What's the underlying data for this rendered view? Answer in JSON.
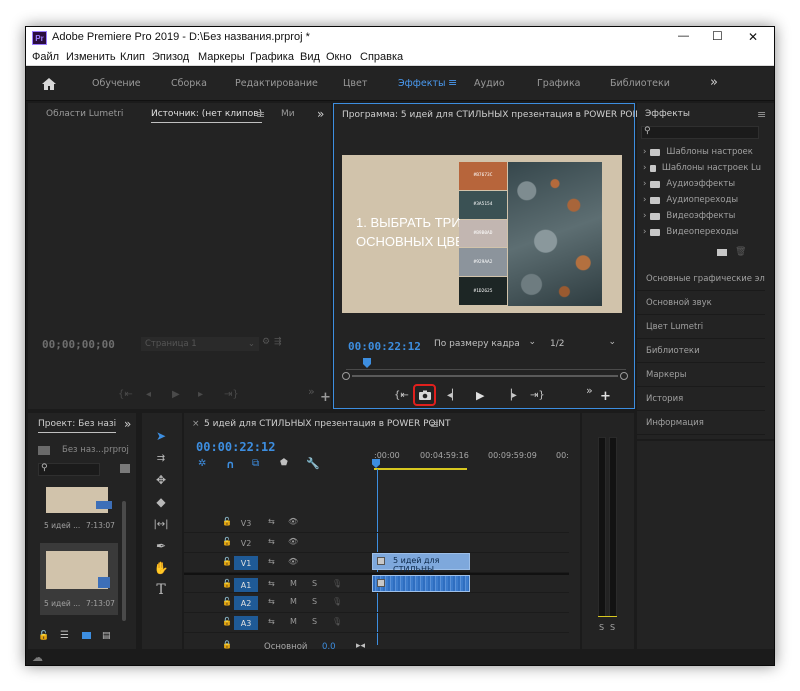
{
  "window": {
    "title": "Adobe Premiere Pro 2019 - D:\\Без названия.prproj *",
    "app_badge": "Pr",
    "minimize": "—",
    "maximize": "☐",
    "close": "✕"
  },
  "menu": [
    "Файл",
    "Изменить",
    "Клип",
    "Эпизод",
    "Маркеры",
    "Графика",
    "Вид",
    "Окно",
    "Справка"
  ],
  "workspaces": {
    "items": [
      "Обучение",
      "Сборка",
      "Редактирование",
      "Цвет",
      "Эффекты",
      "Аудио",
      "Графика",
      "Библиотеки"
    ],
    "active": "Эффекты",
    "more": "»"
  },
  "source": {
    "tabs": [
      "Области Lumetri",
      "Источник: (нет клипов)",
      "Ми"
    ],
    "timecode": "00;00;00;00",
    "page_select": "Страница 1"
  },
  "program": {
    "title": "Программа: 5 идей для СТИЛЬНЫХ презентация в POWER POINT",
    "timecode": "00:00:22:12",
    "fit_select": "По размеру кадра",
    "res_select": "1/2",
    "slide_text_line1": "1. ВЫБРАТЬ ТРИ",
    "slide_text_line2": "ОСНОВНЫХ ЦВЕТА",
    "swatches": [
      {
        "label": "#B7673C",
        "color": "#b7653b"
      },
      {
        "label": "#3A5154",
        "color": "#3a5154"
      },
      {
        "label": "#B9B0AD",
        "color": "#c2b6b1"
      },
      {
        "label": "#929AA2",
        "color": "#8c949c"
      },
      {
        "label": "#1D2625",
        "color": "#1d2625"
      }
    ],
    "slide_colors": {
      "background": "#d1c3ab"
    }
  },
  "effects": {
    "title": "Эффекты",
    "menu": "≡",
    "items": [
      "Шаблоны настроек",
      "Шаблоны настроек Lu",
      "Аудиоэффекты",
      "Аудиопереходы",
      "Видеоэффекты",
      "Видеопереходы"
    ],
    "sections": [
      "Основные графические эле",
      "Основной звук",
      "Цвет Lumetri",
      "Библиотеки",
      "Маркеры",
      "История",
      "Информация"
    ]
  },
  "project": {
    "tab": "Проект: Без назі",
    "file": "Без наз...prproj",
    "clips": [
      {
        "name": "5 идей ...",
        "duration": "7:13:07"
      },
      {
        "name": "5 идей ...",
        "duration": "7:13:07"
      }
    ]
  },
  "timeline": {
    "title": "5 идей для СТИЛЬНЫХ презентация в POWER POINT",
    "timecode": "00:00:22:12",
    "ruler": [
      ":00:00",
      "00:04:59:16",
      "00:09:59:09",
      "00:"
    ],
    "tracks": [
      {
        "name": "V3",
        "type": "video",
        "active": false
      },
      {
        "name": "V2",
        "type": "video",
        "active": false
      },
      {
        "name": "V1",
        "type": "video",
        "active": true
      },
      {
        "name": "A1",
        "type": "audio",
        "active": true
      },
      {
        "name": "A2",
        "type": "audio",
        "active": true
      },
      {
        "name": "A3",
        "type": "audio",
        "active": true
      }
    ],
    "clip_label": "5 идей для СТИЛЬНЫ",
    "master_label": "Основной",
    "master_value": "0,0",
    "mute_label": "M",
    "solo_label": "S"
  },
  "meter": {
    "solo1": "S",
    "solo2": "S"
  },
  "colors": {
    "accent": "#3d8ee0",
    "highlight": "#e0201d",
    "panel": "#232323"
  }
}
